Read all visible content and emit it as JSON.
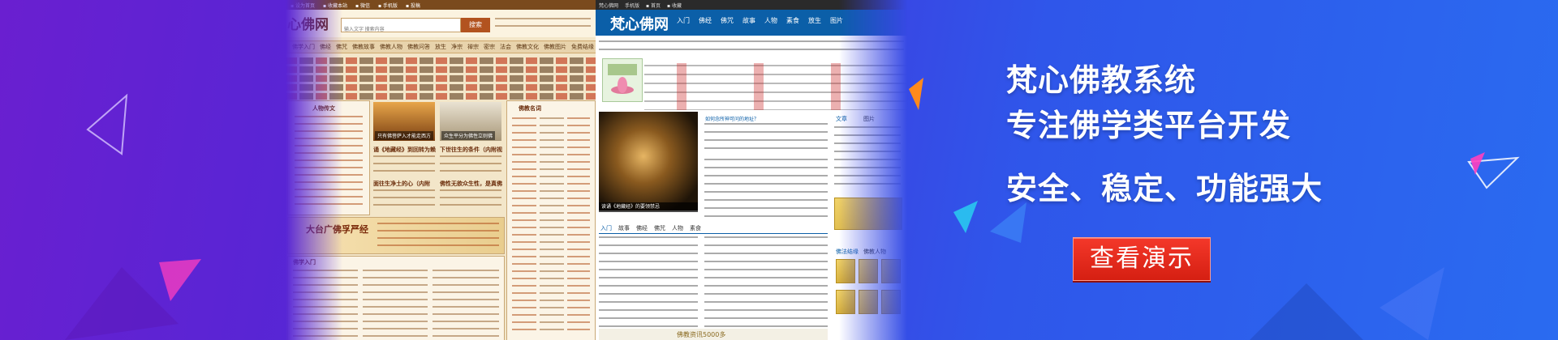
{
  "banner": {
    "headline_1": "梵心佛教系统",
    "headline_2": "专注佛学类平台开发",
    "headline_3": "安全、稳定、功能强大",
    "button_label": "查看演示",
    "colors": {
      "accent": "#e2261a",
      "bg_left": "#6a1fd0",
      "bg_right": "#2a6bf0"
    }
  },
  "shot_left": {
    "logo": "心佛网",
    "search_placeholder": "输入文字 搜索内容",
    "search_button": "搜索",
    "nav": [
      "佛学入门",
      "佛经",
      "佛咒",
      "佛教故事",
      "佛教人物",
      "佛教问答",
      "放生",
      "净宗",
      "禅宗",
      "密宗",
      "法会",
      "佛教文化",
      "佛教图片",
      "免费结缘"
    ],
    "caption_1": "只有佛菩萨入才能走西方",
    "caption_2": "众生平分为佛性立则佛",
    "headline_1": "诵《地藏经》到回转为赖",
    "headline_2": "下世往生的条件（内附视",
    "headline_3": "面往生净土的心（内附",
    "headline_4": "佛性无欲众生性，是真佛",
    "section_1": "人物传文",
    "section_2": "佛教名词",
    "banner_text": "大台广佛孚严经",
    "section_3": "佛学入门"
  },
  "shot_right": {
    "logo": "梵心佛网",
    "nav": [
      "入门",
      "佛经",
      "佛咒",
      "故事",
      "人物",
      "素食",
      "放生",
      "图片"
    ],
    "photo_caption": "读诵《地藏经》的要领禁忌",
    "head_link": "如何念所神可问的地址？",
    "tabs": [
      "入门",
      "故事",
      "佛经",
      "佛咒",
      "人物",
      "素食"
    ],
    "side_tab_1": "文章",
    "side_tab_2": "图片",
    "side_tab_3": "佛法结缘",
    "side_tab_4": "佛教人物",
    "footer_text": "佛教资讯5000多"
  }
}
